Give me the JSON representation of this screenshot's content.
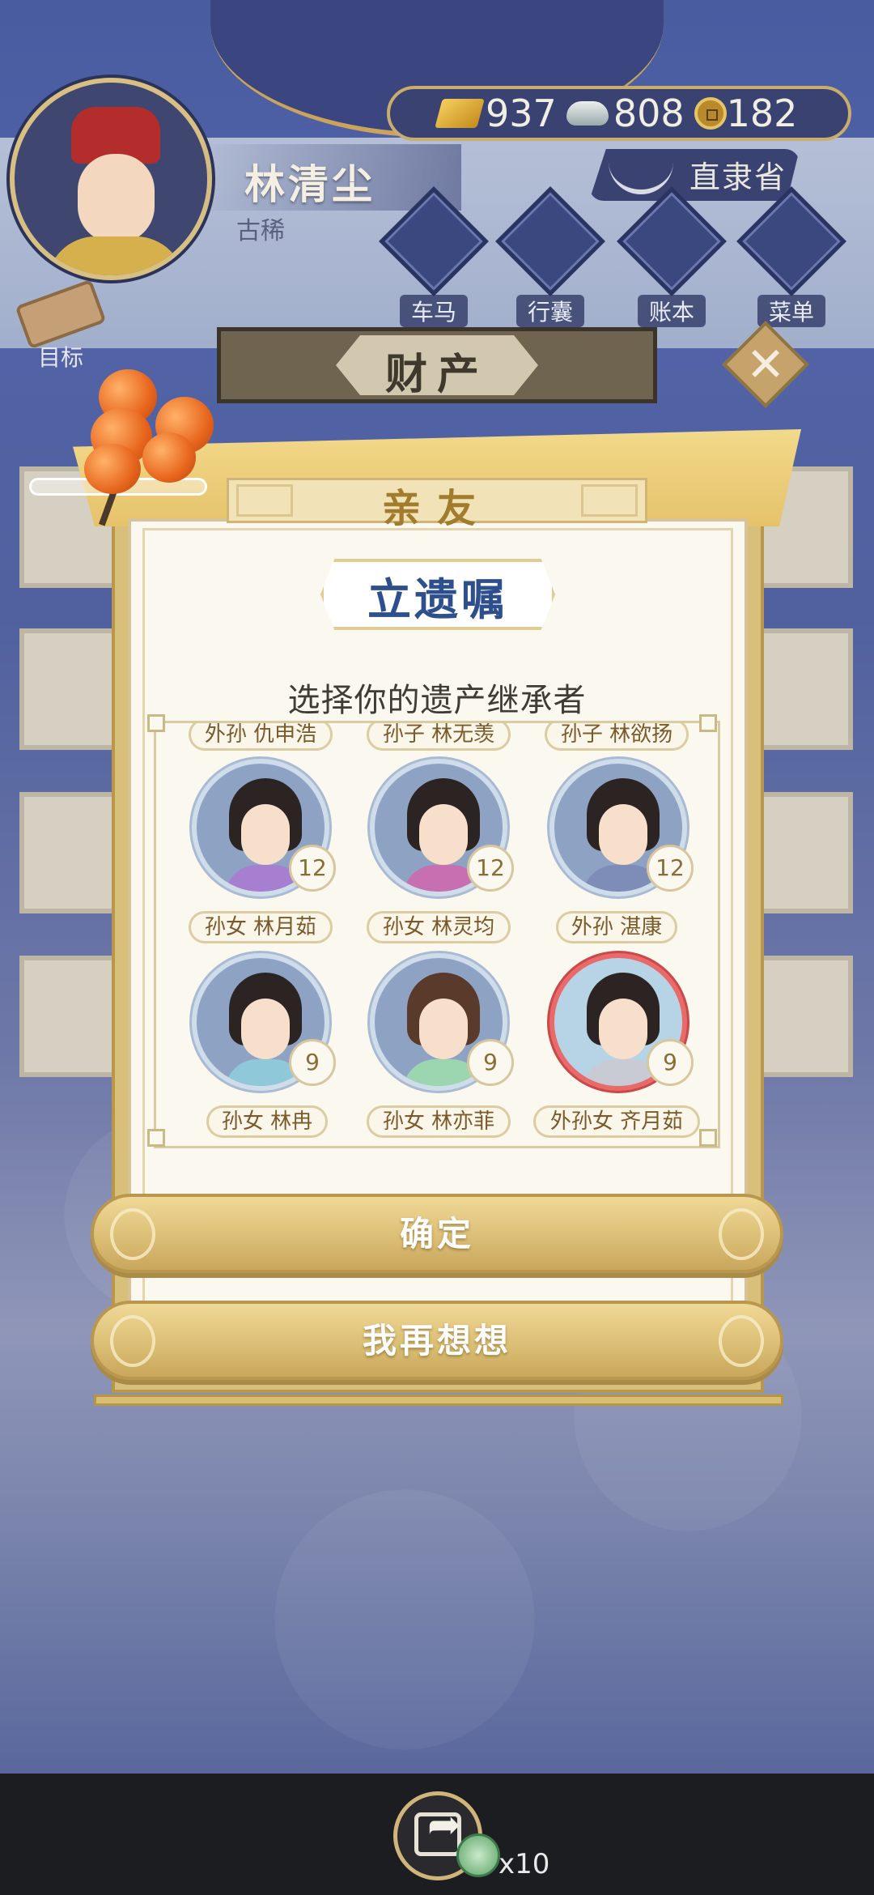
{
  "player": {
    "name": "林清尘",
    "age_title": "古稀"
  },
  "currency": {
    "gold": "937",
    "silver": "808",
    "coins": "182"
  },
  "province": "直隶省",
  "nav": [
    {
      "label": "车马",
      "icon": "carriage-icon"
    },
    {
      "label": "行囊",
      "icon": "bag-icon"
    },
    {
      "label": "账本",
      "icon": "ledger-icon"
    },
    {
      "label": "菜单",
      "icon": "menu-icon"
    }
  ],
  "goal_label": "目标",
  "property_title": "财产",
  "dialog": {
    "tab": "亲友",
    "title": "立遗嘱",
    "subtitle": "选择你的遗产继承者",
    "partial_row": [
      "外孙 仇申浩",
      "孙子 林无羡",
      "孙子 林欲扬"
    ],
    "heirs": [
      {
        "label": "孙女 林月茹",
        "level": "12"
      },
      {
        "label": "孙女 林灵均",
        "level": "12"
      },
      {
        "label": "外孙 湛康",
        "level": "12"
      },
      {
        "label": "孙女 林冉",
        "level": "9"
      },
      {
        "label": "孙女 林亦菲",
        "level": "9"
      },
      {
        "label": "外孙女 齐月茹",
        "level": "9"
      }
    ],
    "confirm": "确定",
    "reconsider": "我再想想"
  },
  "share": {
    "count": "x10"
  },
  "colors": {
    "accent_gold": "#d8bf7a",
    "title_blue": "#2d4f8e",
    "background": "#4a5ca0"
  }
}
